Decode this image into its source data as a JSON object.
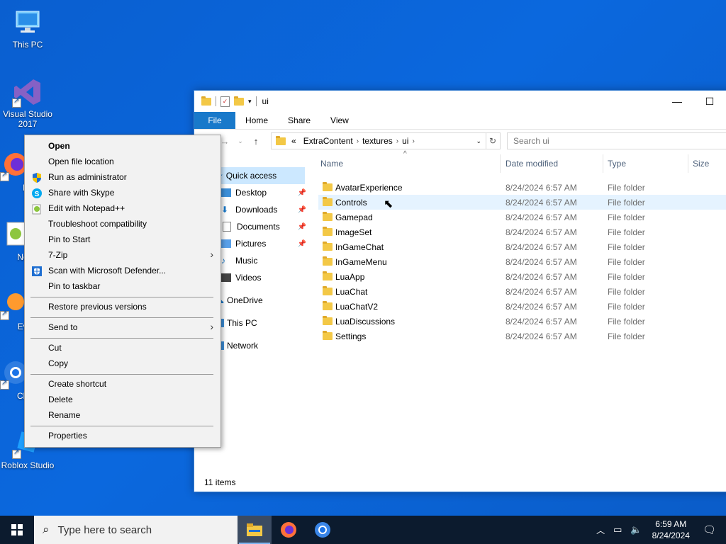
{
  "desktop": {
    "icons": [
      {
        "label": "This PC"
      },
      {
        "label": "Visual Studio 2017"
      },
      {
        "label": "Fi"
      },
      {
        "label": "Note"
      },
      {
        "label": "Ever"
      },
      {
        "label": "Chro"
      },
      {
        "label": "Roblox Studio"
      }
    ]
  },
  "explorer": {
    "title": "ui",
    "ribbon_tabs": [
      "File",
      "Home",
      "Share",
      "View"
    ],
    "breadcrumb": [
      "«",
      "ExtraContent",
      "textures",
      "ui"
    ],
    "search_placeholder": "Search ui",
    "nav": {
      "quick_access": "Quick access",
      "items": [
        "Desktop",
        "Downloads",
        "Documents",
        "Pictures",
        "Music",
        "Videos",
        "OneDrive",
        "This PC",
        "Network"
      ]
    },
    "columns": {
      "name": "Name",
      "date": "Date modified",
      "type": "Type",
      "size": "Size"
    },
    "files": [
      {
        "name": "AvatarExperience",
        "date": "8/24/2024 6:57 AM",
        "type": "File folder"
      },
      {
        "name": "Controls",
        "date": "8/24/2024 6:57 AM",
        "type": "File folder"
      },
      {
        "name": "Gamepad",
        "date": "8/24/2024 6:57 AM",
        "type": "File folder"
      },
      {
        "name": "ImageSet",
        "date": "8/24/2024 6:57 AM",
        "type": "File folder"
      },
      {
        "name": "InGameChat",
        "date": "8/24/2024 6:57 AM",
        "type": "File folder"
      },
      {
        "name": "InGameMenu",
        "date": "8/24/2024 6:57 AM",
        "type": "File folder"
      },
      {
        "name": "LuaApp",
        "date": "8/24/2024 6:57 AM",
        "type": "File folder"
      },
      {
        "name": "LuaChat",
        "date": "8/24/2024 6:57 AM",
        "type": "File folder"
      },
      {
        "name": "LuaChatV2",
        "date": "8/24/2024 6:57 AM",
        "type": "File folder"
      },
      {
        "name": "LuaDiscussions",
        "date": "8/24/2024 6:57 AM",
        "type": "File folder"
      },
      {
        "name": "Settings",
        "date": "8/24/2024 6:57 AM",
        "type": "File folder"
      }
    ],
    "status": "11 items"
  },
  "context_menu": {
    "items": [
      "Open",
      "Open file location",
      "Run as administrator",
      "Share with Skype",
      "Edit with Notepad++",
      "Troubleshoot compatibility",
      "Pin to Start",
      "7-Zip",
      "Scan with Microsoft Defender...",
      "Pin to taskbar",
      "Restore previous versions",
      "Send to",
      "Cut",
      "Copy",
      "Create shortcut",
      "Delete",
      "Rename",
      "Properties"
    ]
  },
  "taskbar": {
    "search_placeholder": "Type here to search",
    "time": "6:59 AM",
    "date": "8/24/2024"
  },
  "colors": {
    "desktop": "#0a5fd0",
    "file_tab": "#1979ca",
    "selection": "#cce8ff",
    "hover": "#e5f3ff",
    "taskbar": "#0c1b2e"
  }
}
